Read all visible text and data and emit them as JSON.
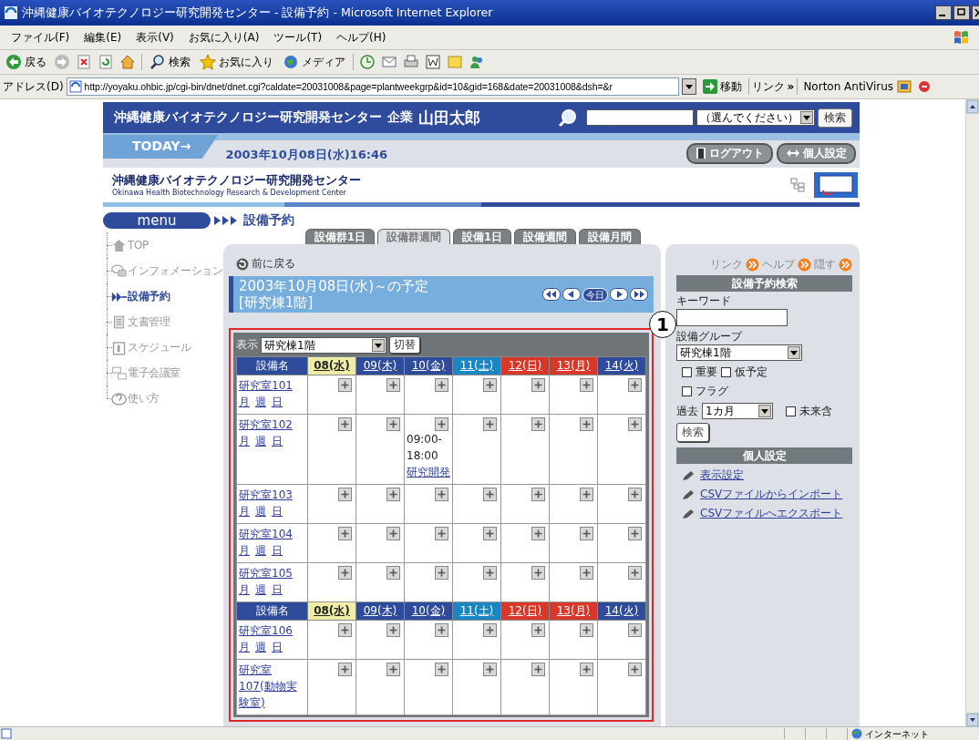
{
  "window": {
    "title": "沖縄健康バイオテクノロジー研究開発センター - 設備予約 - Microsoft Internet Explorer"
  },
  "menu_bar": [
    "ファイル(F)",
    "編集(E)",
    "表示(V)",
    "お気に入り(A)",
    "ツール(T)",
    "ヘルプ(H)"
  ],
  "toolbar": [
    {
      "kind": "back",
      "label": "戻る"
    },
    {
      "kind": "forward"
    },
    {
      "kind": "stop"
    },
    {
      "kind": "refresh"
    },
    {
      "kind": "home"
    },
    {
      "kind": "search",
      "label": "検索"
    },
    {
      "kind": "favorites",
      "label": "お気に入り"
    },
    {
      "kind": "media",
      "label": "メディア"
    },
    {
      "kind": "history"
    },
    {
      "kind": "mail"
    },
    {
      "kind": "print"
    },
    {
      "kind": "edit"
    },
    {
      "kind": "discuss"
    },
    {
      "kind": "messenger"
    }
  ],
  "address_bar": {
    "label": "アドレス(D)",
    "url": "http://yoyaku.ohbic.jp/cgi-bin/dnet/dnet.cgi?caldate=20031008&page=plantweekgrp&id=10&gid=168&date=20031008&dsh=&r",
    "go": "移動",
    "links": "リンク",
    "chevron": "»",
    "extension": "Norton AntiVirus"
  },
  "header": {
    "organization": "沖縄健康バイオテクノロジー研究開発センター",
    "company": "企業",
    "user": "山田太郎",
    "search_scope": "（選んでください）",
    "search_button": "検索"
  },
  "today_bar": {
    "label": "TODAY→",
    "datetime": "2003年10月08日(水)16:46",
    "logout": "ログアウト",
    "settings": "個人設定"
  },
  "logo": {
    "name": "沖縄健康バイオテクノロジー研究開発センター",
    "subtitle": "Okinawa Health Biotechnology Research & Development Center"
  },
  "menu_label": "menu",
  "breadcrumb": "設備予約",
  "nav": [
    {
      "kind": "home",
      "label": "TOP",
      "selected": false
    },
    {
      "kind": "info",
      "label": "インフォメーション",
      "selected": false
    },
    {
      "kind": "reserve",
      "label": "設備予約",
      "selected": true
    },
    {
      "kind": "docs",
      "label": "文書管理",
      "selected": false
    },
    {
      "kind": "schedule",
      "label": "スケジュール",
      "selected": false
    },
    {
      "kind": "meeting",
      "label": "電子会議室",
      "selected": false
    },
    {
      "kind": "help",
      "label": "使い方",
      "selected": false
    }
  ],
  "tabs": [
    {
      "label": "設備群1日",
      "selected": false
    },
    {
      "label": "設備群週間",
      "selected": true
    },
    {
      "label": "設備1日",
      "selected": false
    },
    {
      "label": "設備週間",
      "selected": false
    },
    {
      "label": "設備月間",
      "selected": false
    }
  ],
  "schedule": {
    "back": "前に戻る",
    "title": "2003年10月08日(水)～の予定",
    "subtitle": "[研究棟1階]",
    "today_button": "今日",
    "filter_label": "表示",
    "filter_value": "研究棟1階",
    "switch_button": "切替",
    "sections": [
      {
        "name_header": "設備名",
        "days": [
          {
            "label": "08(水)",
            "kind": "today"
          },
          {
            "label": "09(木)",
            "kind": "weekday"
          },
          {
            "label": "10(金)",
            "kind": "weekday"
          },
          {
            "label": "11(土)",
            "kind": "saturday"
          },
          {
            "label": "12(日)",
            "kind": "holiday"
          },
          {
            "label": "13(月)",
            "kind": "holiday"
          },
          {
            "label": "14(火)",
            "kind": "weekday"
          }
        ],
        "rows": [
          {
            "name": "研究室101",
            "views": [
              "月",
              "週",
              "日"
            ],
            "cells": [
              {
                "kind": "free"
              },
              {
                "kind": "free"
              },
              {
                "kind": "free"
              },
              {
                "kind": "free"
              },
              {
                "kind": "free"
              },
              {
                "kind": "free"
              },
              {
                "kind": "free"
              }
            ]
          },
          {
            "name": "研究室102",
            "views": [
              "月",
              "週",
              "日"
            ],
            "cells": [
              {
                "kind": "free"
              },
              {
                "kind": "free"
              },
              {
                "kind": "booked",
                "time": "09:00-18:00",
                "title": "研究開発"
              },
              {
                "kind": "free"
              },
              {
                "kind": "free"
              },
              {
                "kind": "free"
              },
              {
                "kind": "free"
              }
            ]
          },
          {
            "name": "研究室103",
            "views": [
              "月",
              "週",
              "日"
            ],
            "cells": [
              {
                "kind": "free"
              },
              {
                "kind": "free"
              },
              {
                "kind": "free"
              },
              {
                "kind": "free"
              },
              {
                "kind": "free"
              },
              {
                "kind": "free"
              },
              {
                "kind": "free"
              }
            ]
          },
          {
            "name": "研究室104",
            "views": [
              "月",
              "週",
              "日"
            ],
            "cells": [
              {
                "kind": "free"
              },
              {
                "kind": "free"
              },
              {
                "kind": "free"
              },
              {
                "kind": "free"
              },
              {
                "kind": "free"
              },
              {
                "kind": "free"
              },
              {
                "kind": "free"
              }
            ]
          },
          {
            "name": "研究室105",
            "views": [
              "月",
              "週",
              "日"
            ],
            "cells": [
              {
                "kind": "free"
              },
              {
                "kind": "free"
              },
              {
                "kind": "free"
              },
              {
                "kind": "free"
              },
              {
                "kind": "free"
              },
              {
                "kind": "free"
              },
              {
                "kind": "free"
              }
            ]
          }
        ]
      },
      {
        "name_header": "設備名",
        "days": [
          {
            "label": "08(水)",
            "kind": "today"
          },
          {
            "label": "09(木)",
            "kind": "weekday"
          },
          {
            "label": "10(金)",
            "kind": "weekday"
          },
          {
            "label": "11(土)",
            "kind": "saturday"
          },
          {
            "label": "12(日)",
            "kind": "holiday"
          },
          {
            "label": "13(月)",
            "kind": "holiday"
          },
          {
            "label": "14(火)",
            "kind": "weekday"
          }
        ],
        "rows": [
          {
            "name": "研究室106",
            "views": [
              "月",
              "週",
              "日"
            ],
            "cells": [
              {
                "kind": "free"
              },
              {
                "kind": "free"
              },
              {
                "kind": "free"
              },
              {
                "kind": "free"
              },
              {
                "kind": "free"
              },
              {
                "kind": "free"
              },
              {
                "kind": "free"
              }
            ]
          },
          {
            "name": "研究室107(動物実験室)",
            "views": [],
            "cells": [
              {
                "kind": "free"
              },
              {
                "kind": "free"
              },
              {
                "kind": "free"
              },
              {
                "kind": "free"
              },
              {
                "kind": "free"
              },
              {
                "kind": "free"
              },
              {
                "kind": "free"
              }
            ]
          }
        ]
      }
    ]
  },
  "callout": "1",
  "search_panel": {
    "links": [
      "リンク",
      "ヘルプ",
      "隠す"
    ],
    "title": "設備予約検索",
    "keyword_label": "キーワード",
    "group_label": "設備グループ",
    "group_value": "研究棟1階",
    "checkboxes": [
      {
        "label": "重要",
        "checked": false
      },
      {
        "label": "仮予定",
        "checked": false
      },
      {
        "label": "フラグ",
        "checked": false
      }
    ],
    "past_label": "過去",
    "past_value": "1カ月",
    "future": {
      "label": "未来含",
      "checked": false
    },
    "search_button": "検索",
    "settings_title": "個人設定",
    "settings_links": [
      "表示設定",
      "CSVファイルからインポート",
      "CSVファイルへエクスポート"
    ]
  },
  "status_bar": {
    "zone": "インターネット"
  }
}
